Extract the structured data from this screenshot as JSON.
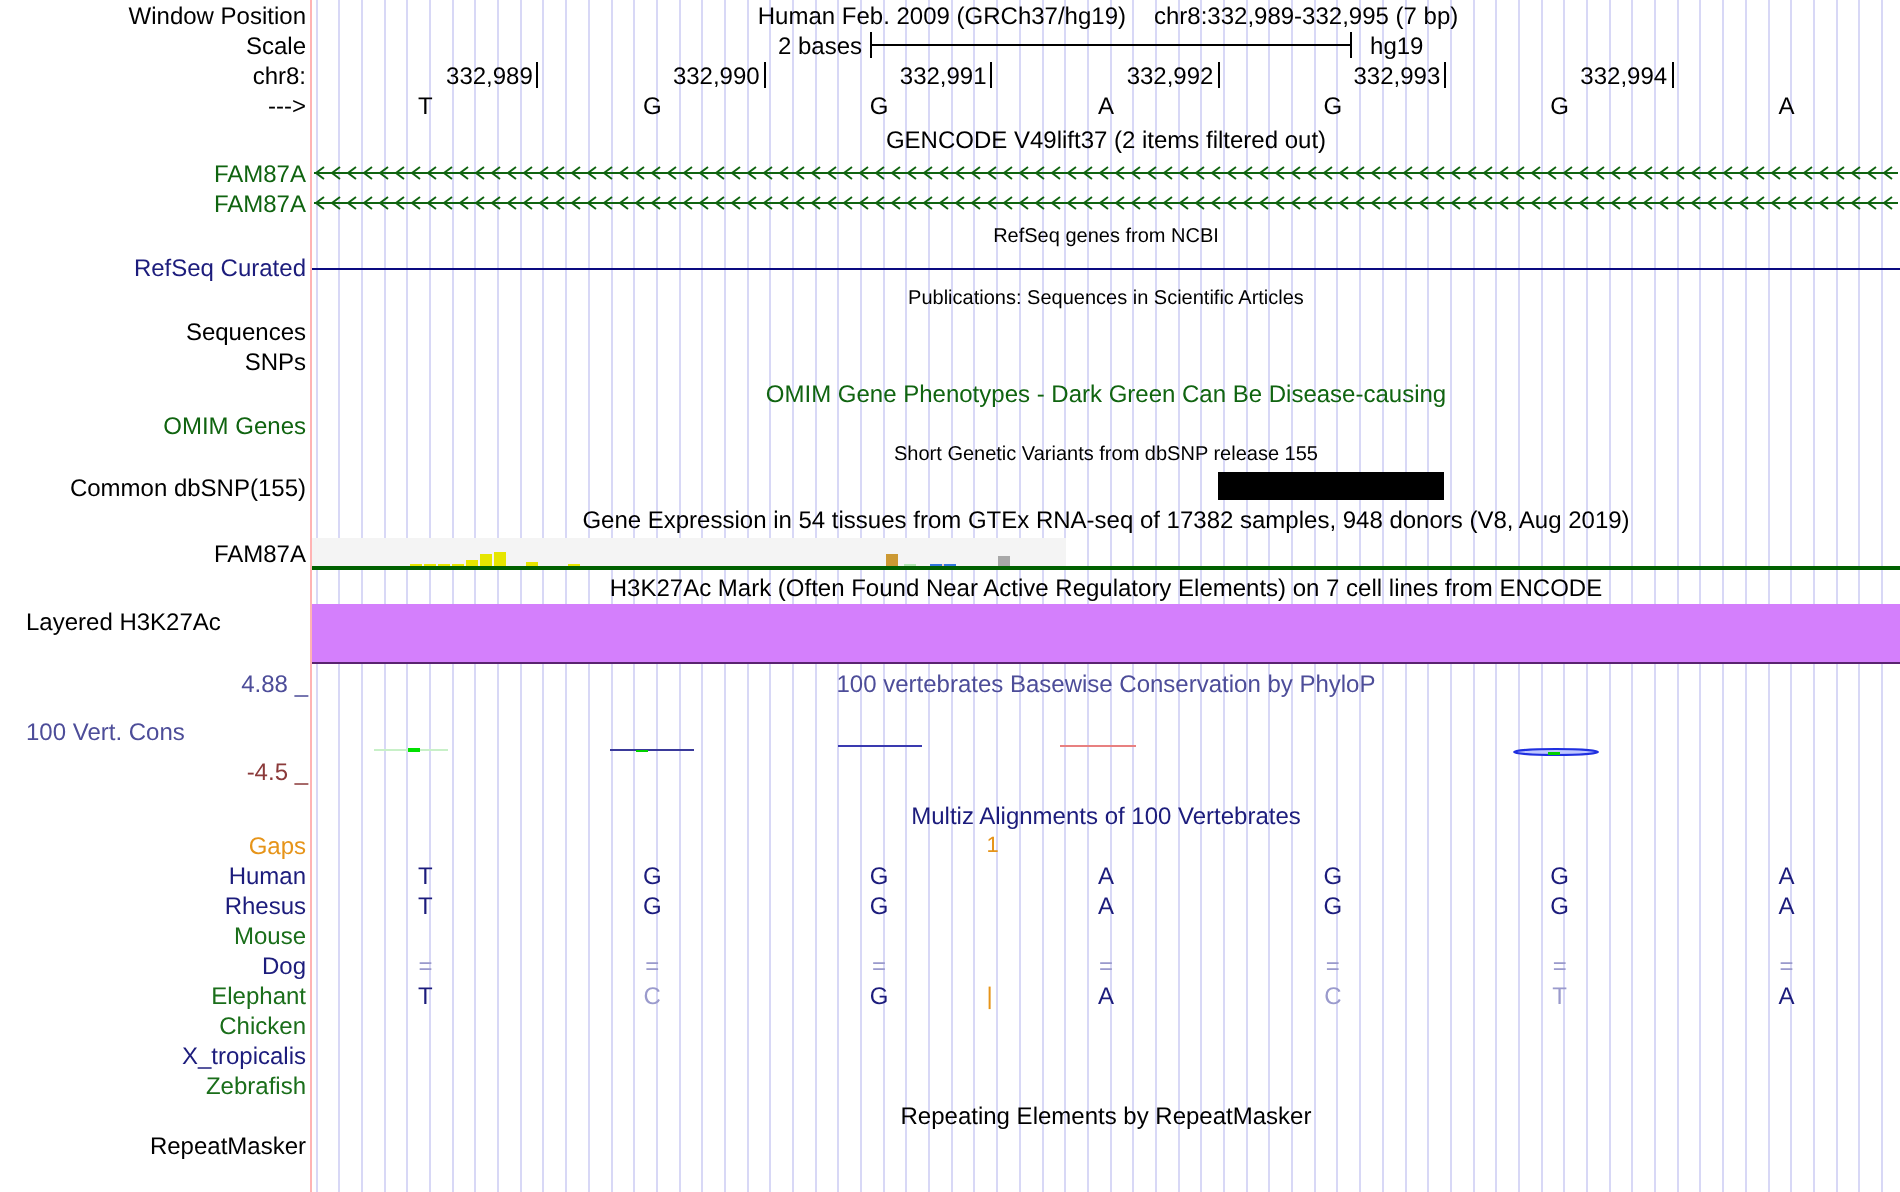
{
  "position": {
    "label": "Window Position",
    "assembly": "Human Feb. 2009 (GRCh37/hg19)",
    "range": "chr8:332,989-332,995 (7 bp)"
  },
  "scale": {
    "label": "Scale",
    "span": "2 bases",
    "assembly": "hg19"
  },
  "coordinates": {
    "label": "chr8:",
    "ticks": [
      "332,989",
      "332,990",
      "332,991",
      "332,992",
      "332,993",
      "332,994"
    ]
  },
  "sequence": {
    "label": "--->",
    "bases": [
      "T",
      "G",
      "G",
      "A",
      "G",
      "G",
      "A"
    ]
  },
  "gencode": {
    "title": "GENCODE V49lift37 (2 items filtered out)",
    "genes": [
      "FAM87A",
      "FAM87A"
    ]
  },
  "refseq": {
    "title": "RefSeq genes from NCBI",
    "label": "RefSeq Curated"
  },
  "publications": {
    "title": "Publications: Sequences in Scientific Articles",
    "labels": [
      "Sequences",
      "SNPs"
    ]
  },
  "omim": {
    "title": "OMIM Gene Phenotypes - Dark Green Can Be Disease-causing",
    "label": "OMIM Genes"
  },
  "dbsnp": {
    "title": "Short Genetic Variants from dbSNP release 155",
    "label": "Common dbSNP(155)"
  },
  "gtex": {
    "title": "Gene Expression in 54 tissues from GTEx RNA-seq of 17382 samples, 948 donors (V8, Aug 2019)",
    "label": "FAM87A"
  },
  "h3k27ac": {
    "title": "H3K27Ac Mark (Often Found Near Active Regulatory Elements) on 7 cell lines from ENCODE",
    "label": "Layered H3K27Ac"
  },
  "conservation": {
    "title": "100 vertebrates Basewise Conservation by PhyloP",
    "label": "100 Vert. Cons",
    "max": "4.88 _",
    "min": "-4.5 _"
  },
  "multiz": {
    "title": "Multiz Alignments of 100 Vertebrates",
    "gaps": {
      "label": "Gaps",
      "cells": [
        {
          "kind": "empty"
        },
        {
          "kind": "empty"
        },
        {
          "kind": "empty"
        },
        {
          "kind": "insertion",
          "text": "1"
        },
        {
          "kind": "empty"
        },
        {
          "kind": "empty"
        },
        {
          "kind": "empty"
        },
        {
          "kind": "empty"
        }
      ]
    },
    "species": [
      {
        "name": "Human",
        "color": "#1c1c7c",
        "bases": [
          {
            "kind": "base",
            "text": "T",
            "faded": false
          },
          {
            "kind": "base",
            "text": "G",
            "faded": false
          },
          {
            "kind": "base",
            "text": "G",
            "faded": false
          },
          {
            "kind": "base",
            "text": "A",
            "faded": false
          },
          {
            "kind": "base",
            "text": "G",
            "faded": false
          },
          {
            "kind": "base",
            "text": "G",
            "faded": false
          },
          {
            "kind": "base",
            "text": "A",
            "faded": false
          }
        ]
      },
      {
        "name": "Rhesus",
        "color": "#1c1c7c",
        "bases": [
          {
            "kind": "base",
            "text": "T",
            "faded": false
          },
          {
            "kind": "base",
            "text": "G",
            "faded": false
          },
          {
            "kind": "base",
            "text": "G",
            "faded": false
          },
          {
            "kind": "base",
            "text": "A",
            "faded": false
          },
          {
            "kind": "base",
            "text": "G",
            "faded": false
          },
          {
            "kind": "base",
            "text": "G",
            "faded": false
          },
          {
            "kind": "base",
            "text": "A",
            "faded": false
          }
        ]
      },
      {
        "name": "Mouse",
        "color": "#1a6e1a"
      },
      {
        "name": "Dog",
        "color": "#1c1c7c",
        "bases": [
          {
            "kind": "base",
            "text": "=",
            "faded": true
          },
          {
            "kind": "base",
            "text": "=",
            "faded": true
          },
          {
            "kind": "base",
            "text": "=",
            "faded": true
          },
          {
            "kind": "base",
            "text": "=",
            "faded": true
          },
          {
            "kind": "base",
            "text": "=",
            "faded": true
          },
          {
            "kind": "base",
            "text": "=",
            "faded": true
          },
          {
            "kind": "base",
            "text": "=",
            "faded": true
          }
        ]
      },
      {
        "name": "Elephant",
        "color": "#1a6e1a",
        "bases": [
          {
            "kind": "base",
            "text": "T",
            "faded": false
          },
          {
            "kind": "base",
            "text": "C",
            "faded": true
          },
          {
            "kind": "base",
            "text": "G",
            "faded": false
          },
          {
            "kind": "insertion",
            "text": "|"
          },
          {
            "kind": "base",
            "text": "A",
            "faded": false
          },
          {
            "kind": "base",
            "text": "C",
            "faded": true
          },
          {
            "kind": "base",
            "text": "T",
            "faded": true
          },
          {
            "kind": "base",
            "text": "A",
            "faded": false
          }
        ]
      },
      {
        "name": "Chicken",
        "color": "#1a6e1a"
      },
      {
        "name": "X_tropicalis",
        "color": "#1c1c7c"
      },
      {
        "name": "Zebrafish",
        "color": "#1a6e1a"
      }
    ]
  },
  "repeatmasker": {
    "title": "Repeating Elements by RepeatMasker",
    "label": "RepeatMasker"
  }
}
